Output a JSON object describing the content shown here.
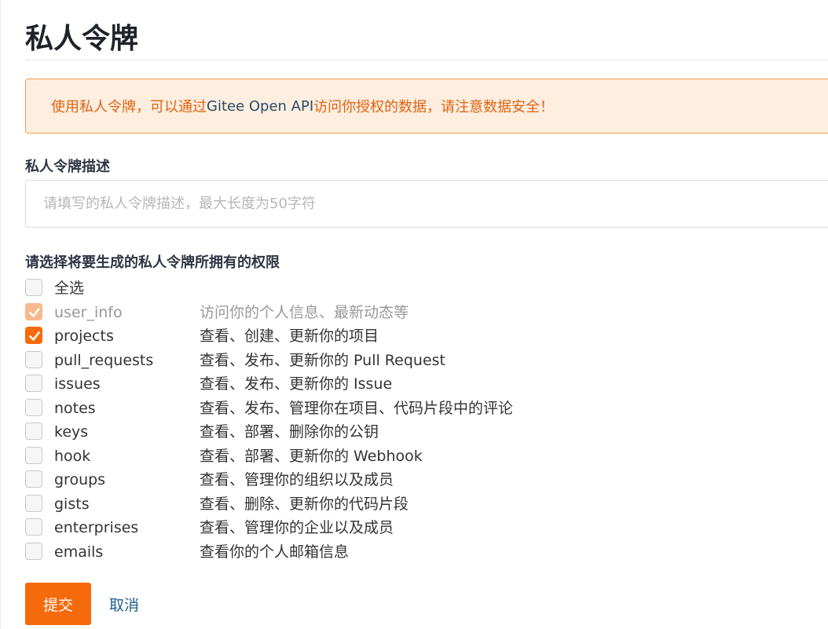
{
  "page": {
    "title": "私人令牌"
  },
  "notice": {
    "prefix": "使用私人令牌，可以通过 ",
    "api": "Gitee Open API",
    "suffix": " 访问你授权的数据，请注意数据安全！"
  },
  "description": {
    "label": "私人令牌描述",
    "placeholder": "请填写的私人令牌描述，最大长度为50字符",
    "value": ""
  },
  "permissions": {
    "label": "请选择将要生成的私人令牌所拥有的权限",
    "select_all": {
      "label": "全选",
      "checked": false
    },
    "items": [
      {
        "name": "user_info",
        "desc": "访问你的个人信息、最新动态等",
        "checked": true,
        "disabled": true
      },
      {
        "name": "projects",
        "desc": "查看、创建、更新你的项目",
        "checked": true,
        "disabled": false
      },
      {
        "name": "pull_requests",
        "desc": "查看、发布、更新你的 Pull Request",
        "checked": false,
        "disabled": false
      },
      {
        "name": "issues",
        "desc": "查看、发布、更新你的 Issue",
        "checked": false,
        "disabled": false
      },
      {
        "name": "notes",
        "desc": "查看、发布、管理你在项目、代码片段中的评论",
        "checked": false,
        "disabled": false
      },
      {
        "name": "keys",
        "desc": "查看、部署、删除你的公钥",
        "checked": false,
        "disabled": false
      },
      {
        "name": "hook",
        "desc": "查看、部署、更新你的 Webhook",
        "checked": false,
        "disabled": false
      },
      {
        "name": "groups",
        "desc": "查看、管理你的组织以及成员",
        "checked": false,
        "disabled": false
      },
      {
        "name": "gists",
        "desc": "查看、删除、更新你的代码片段",
        "checked": false,
        "disabled": false
      },
      {
        "name": "enterprises",
        "desc": "查看、管理你的企业以及成员",
        "checked": false,
        "disabled": false
      },
      {
        "name": "emails",
        "desc": "查看你的个人邮箱信息",
        "checked": false,
        "disabled": false
      }
    ]
  },
  "actions": {
    "submit": "提交",
    "cancel": "取消"
  },
  "colors": {
    "accent": "#f56a0b",
    "notice_bg": "#fdeee0",
    "notice_text": "#e06310",
    "link": "#1d5e8c"
  }
}
